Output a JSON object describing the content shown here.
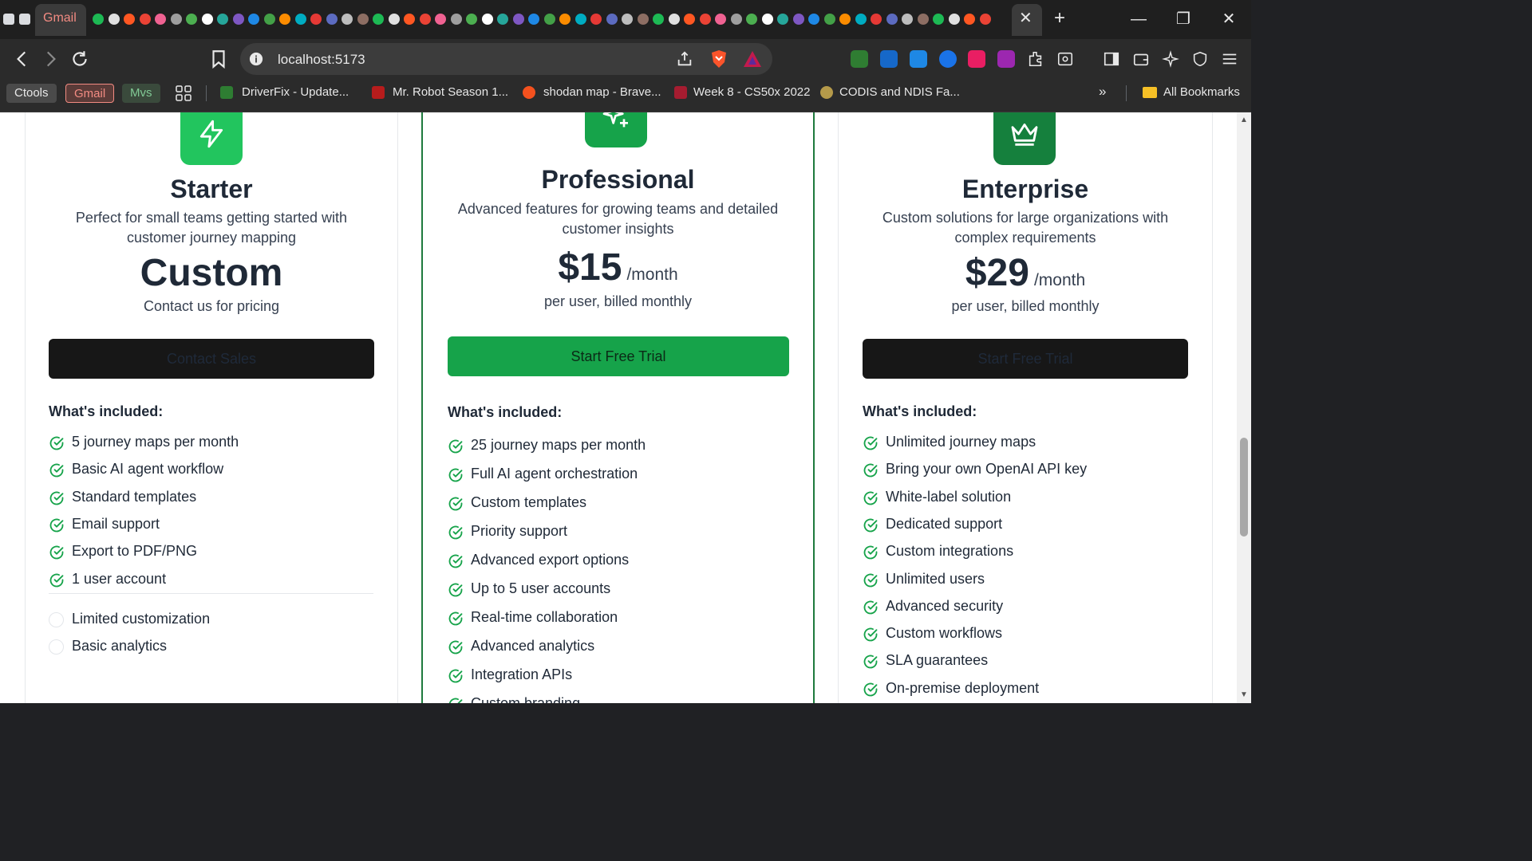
{
  "browser": {
    "tab_label": "Gmail",
    "url": "localhost:5173",
    "bookmarks": [
      {
        "label": "Ctools"
      },
      {
        "label": "Gmail"
      },
      {
        "label": "Mvs"
      },
      {
        "label": "DriverFix - Update..."
      },
      {
        "label": "Mr. Robot Season 1..."
      },
      {
        "label": "shodan map - Brave..."
      },
      {
        "label": "Week 8 - CS50x 2022"
      },
      {
        "label": "CODIS and NDIS Fa..."
      },
      {
        "label": "All Bookmarks"
      }
    ]
  },
  "plans": {
    "starter": {
      "name": "Starter",
      "description": "Perfect for small teams getting started with customer journey mapping",
      "price": "Custom",
      "price_sub": "Contact us for pricing",
      "cta": "Contact Sales",
      "included_heading": "What's included:",
      "features": [
        "5 journey maps per month",
        "Basic AI agent workflow",
        "Standard templates",
        "Email support",
        "Export to PDF/PNG",
        "1 user account"
      ],
      "limitations": [
        "Limited customization",
        "Basic analytics"
      ]
    },
    "professional": {
      "name": "Professional",
      "description": "Advanced features for growing teams and detailed customer insights",
      "price": "$15",
      "period": "/month",
      "price_sub": "per user, billed monthly",
      "cta": "Start Free Trial",
      "included_heading": "What's included:",
      "features": [
        "25 journey maps per month",
        "Full AI agent orchestration",
        "Custom templates",
        "Priority support",
        "Advanced export options",
        "Up to 5 user accounts",
        "Real-time collaboration",
        "Advanced analytics",
        "Integration APIs",
        "Custom branding"
      ]
    },
    "enterprise": {
      "name": "Enterprise",
      "description": "Custom solutions for large organizations with complex requirements",
      "price": "$29",
      "period": "/month",
      "price_sub": "per user, billed monthly",
      "cta": "Start Free Trial",
      "included_heading": "What's included:",
      "features": [
        "Unlimited journey maps",
        "Bring your own OpenAI API key",
        "White-label solution",
        "Dedicated support",
        "Custom integrations",
        "Unlimited users",
        "Advanced security",
        "Custom workflows",
        "SLA guarantees",
        "On-premise deployment"
      ]
    }
  },
  "colors": {
    "accent_green": "#16a34a",
    "enterprise_green": "#15803d",
    "pro_border": "#1e7a3d",
    "dark_button": "#171717"
  }
}
